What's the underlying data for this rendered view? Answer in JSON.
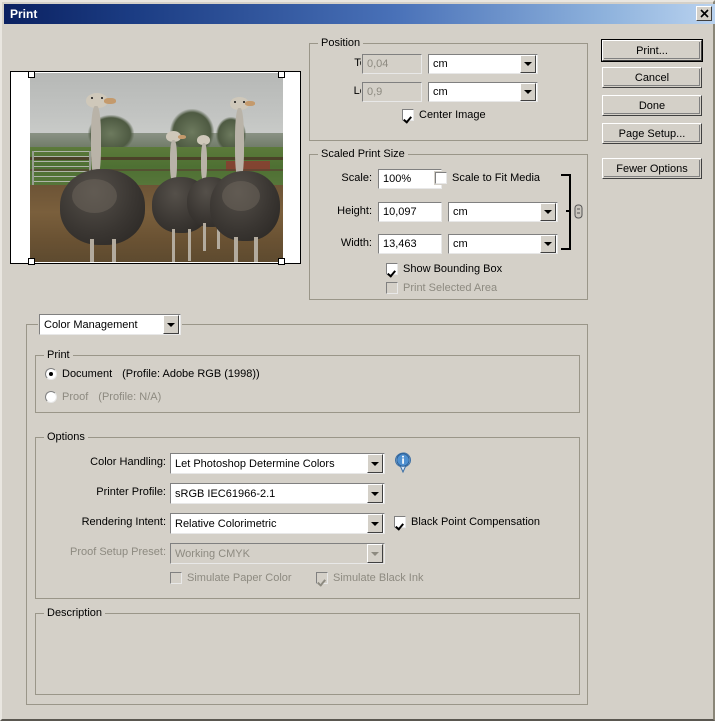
{
  "window": {
    "title": "Print",
    "close_icon": "close-icon"
  },
  "buttons": {
    "print": "Print...",
    "cancel": "Cancel",
    "done": "Done",
    "page_setup": "Page Setup...",
    "fewer_options": "Fewer Options"
  },
  "position": {
    "legend": "Position",
    "top_label": "Top:",
    "top_value": "0,04",
    "top_unit": "cm",
    "left_label": "Left:",
    "left_value": "0,9",
    "left_unit": "cm",
    "center_image_label": "Center Image",
    "center_image_checked": true
  },
  "scaled_print_size": {
    "legend": "Scaled Print Size",
    "scale_label": "Scale:",
    "scale_value": "100%",
    "scale_to_fit_label": "Scale to Fit Media",
    "scale_to_fit_checked": false,
    "height_label": "Height:",
    "height_value": "10,097",
    "height_unit": "cm",
    "width_label": "Width:",
    "width_value": "13,463",
    "width_unit": "cm",
    "link_icon": "chain-link-icon",
    "show_bounding_box_label": "Show Bounding Box",
    "show_bounding_box_checked": true,
    "print_selected_area_label": "Print Selected Area",
    "print_selected_area_checked": false
  },
  "section_selector": {
    "value": "Color Management"
  },
  "print_group": {
    "legend": "Print",
    "document_label": "Document",
    "document_profile": "(Profile: Adobe RGB (1998))",
    "document_selected": true,
    "proof_label": "Proof",
    "proof_profile": "(Profile: N/A)",
    "proof_selected": false
  },
  "options": {
    "legend": "Options",
    "color_handling_label": "Color Handling:",
    "color_handling_value": "Let Photoshop Determine Colors",
    "info_icon": "info-icon",
    "printer_profile_label": "Printer Profile:",
    "printer_profile_value": "sRGB IEC61966-2.1",
    "rendering_intent_label": "Rendering Intent:",
    "rendering_intent_value": "Relative Colorimetric",
    "black_point_label": "Black Point Compensation",
    "black_point_checked": true,
    "proof_setup_label": "Proof Setup Preset:",
    "proof_setup_value": "Working CMYK",
    "simulate_paper_label": "Simulate Paper Color",
    "simulate_paper_checked": false,
    "simulate_black_label": "Simulate Black Ink",
    "simulate_black_checked": true
  },
  "description": {
    "legend": "Description",
    "text": ""
  },
  "preview": {
    "image_alt": "ostriches-in-farm-pen-photo"
  },
  "colors": {
    "dialog_face": "#d4d0c8",
    "title_start": "#0b2161",
    "title_end": "#b9d2ef",
    "disabled_text": "#8d8a80",
    "info_blue": "#2b6fba"
  }
}
